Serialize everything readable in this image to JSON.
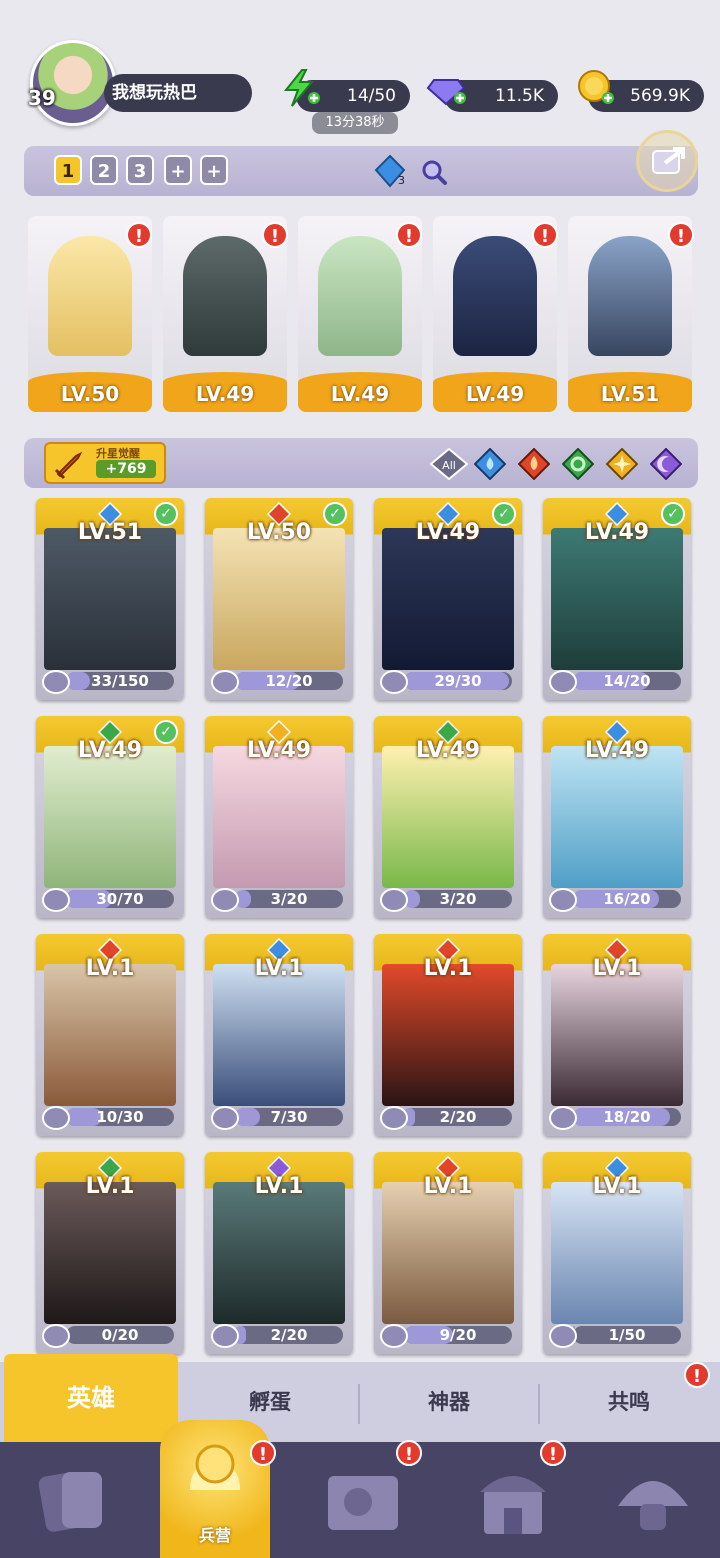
{
  "player": {
    "level": "39",
    "name": "我想玩热巴"
  },
  "resources": {
    "energy": "14/50",
    "energy_timer": "13分38秒",
    "gems": "11.5K",
    "gold": "569.9K"
  },
  "team_tabs": [
    "1",
    "2",
    "3",
    "+",
    "+"
  ],
  "gem_counter": "3",
  "team": [
    {
      "element": "fire",
      "level": "LV.50"
    },
    {
      "element": "water",
      "level": "LV.49"
    },
    {
      "element": "wind",
      "level": "LV.49"
    },
    {
      "element": "water",
      "level": "LV.49"
    },
    {
      "element": "water",
      "level": "LV.51"
    }
  ],
  "awaken": {
    "title": "升星觉醒",
    "count": "+769"
  },
  "filters": [
    "All",
    "water",
    "fire",
    "wind",
    "light",
    "dark"
  ],
  "heroes": [
    {
      "level": "LV.51",
      "element": "water",
      "progress": "33/150",
      "fraction": 0.22,
      "checked": true
    },
    {
      "level": "LV.50",
      "element": "fire",
      "progress": "12/20",
      "fraction": 0.6,
      "checked": true
    },
    {
      "level": "LV.49",
      "element": "water",
      "progress": "29/30",
      "fraction": 0.97,
      "checked": true
    },
    {
      "level": "LV.49",
      "element": "water",
      "progress": "14/20",
      "fraction": 0.7,
      "checked": true
    },
    {
      "level": "LV.49",
      "element": "wind",
      "progress": "30/70",
      "fraction": 0.43,
      "checked": true
    },
    {
      "level": "LV.49",
      "element": "light",
      "progress": "3/20",
      "fraction": 0.15,
      "checked": false
    },
    {
      "level": "LV.49",
      "element": "wind",
      "progress": "3/20",
      "fraction": 0.15,
      "checked": false
    },
    {
      "level": "LV.49",
      "element": "water",
      "progress": "16/20",
      "fraction": 0.8,
      "checked": false
    },
    {
      "level": "LV.1",
      "element": "fire",
      "progress": "10/30",
      "fraction": 0.33,
      "checked": false
    },
    {
      "level": "LV.1",
      "element": "water",
      "progress": "7/30",
      "fraction": 0.23,
      "checked": false
    },
    {
      "level": "LV.1",
      "element": "fire",
      "progress": "2/20",
      "fraction": 0.1,
      "checked": false
    },
    {
      "level": "LV.1",
      "element": "fire",
      "progress": "18/20",
      "fraction": 0.9,
      "checked": false
    },
    {
      "level": "LV.1",
      "element": "wind",
      "progress": "0/20",
      "fraction": 0.0,
      "checked": false
    },
    {
      "level": "LV.1",
      "element": "dark",
      "progress": "2/20",
      "fraction": 0.1,
      "checked": false
    },
    {
      "level": "LV.1",
      "element": "fire",
      "progress": "9/20",
      "fraction": 0.45,
      "checked": false
    },
    {
      "level": "LV.1",
      "element": "water",
      "progress": "1/50",
      "fraction": 0.02,
      "checked": false
    }
  ],
  "subtabs": [
    "英雄",
    "孵蛋",
    "神器",
    "共鸣"
  ],
  "bottom_nav": {
    "active_label": "兵营"
  },
  "colors": {
    "accent": "#f6c52b",
    "water": "#3c8fe0",
    "fire": "#e0452a",
    "wind": "#3aa84a",
    "light": "#f0b020",
    "dark": "#8a5ad8"
  }
}
